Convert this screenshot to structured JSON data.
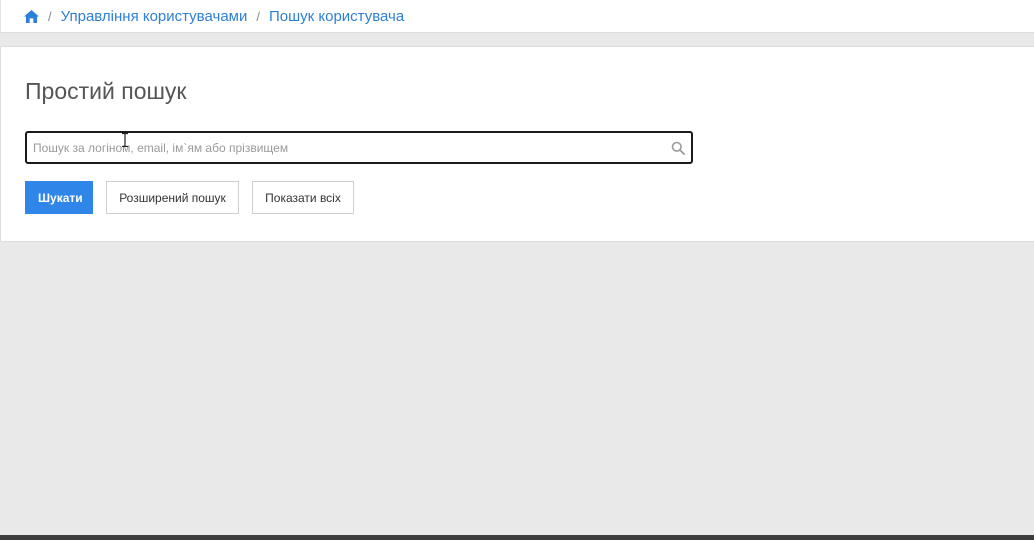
{
  "breadcrumb": {
    "home_icon": "home-icon",
    "separator": "/",
    "items": [
      {
        "label": "Управління користувачами"
      },
      {
        "label": "Пошук користувача"
      }
    ]
  },
  "search_panel": {
    "title": "Простий пошук",
    "input": {
      "placeholder": "Пошук за логіном, email, ім`ям або прізвищем",
      "value": "",
      "icon": "search-icon"
    },
    "buttons": {
      "search_label": "Шукати",
      "advanced_label": "Розширений пошук",
      "show_all_label": "Показати всіх"
    }
  },
  "colors": {
    "accent": "#2f86e8",
    "link": "#2e7fd6",
    "background": "#e9e9e9"
  }
}
